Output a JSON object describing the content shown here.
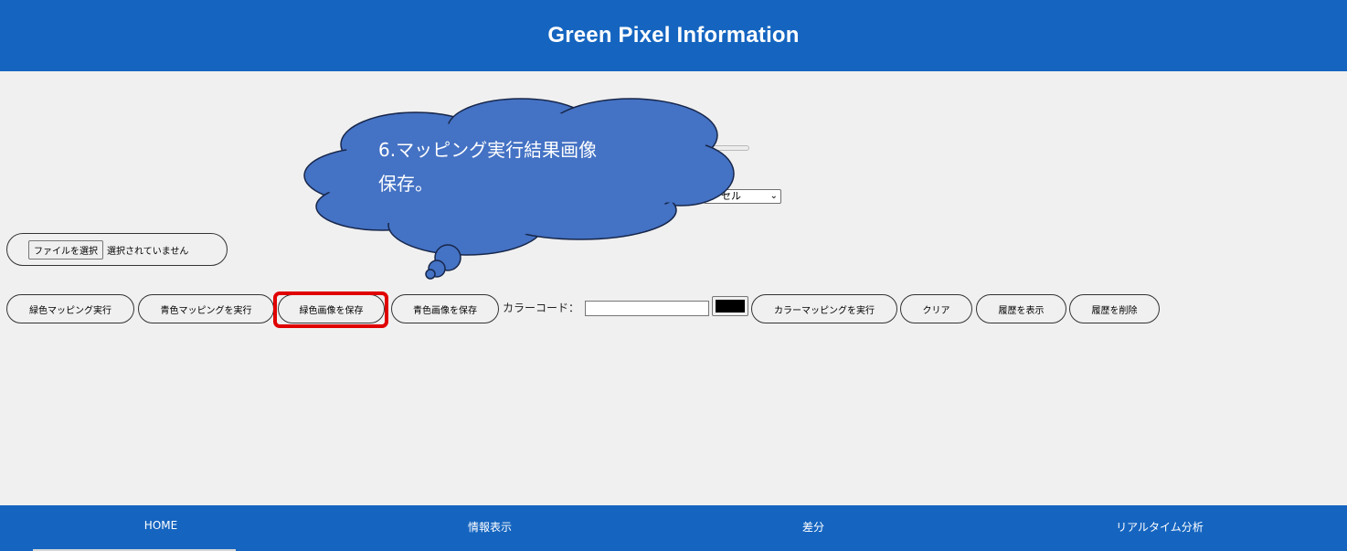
{
  "header": {
    "title": "Green Pixel Information"
  },
  "settings": {
    "select_value": "セル",
    "select_chevron": "⌄"
  },
  "file": {
    "choose_label": "ファイルを選択",
    "status": "選択されていません"
  },
  "toolbar": {
    "green_mapping": "緑色マッピング実行",
    "blue_mapping": "青色マッピングを実行",
    "save_green": "緑色画像を保存",
    "save_blue": "青色画像を保存",
    "color_code_label": "カラーコード：",
    "color_code_value": "",
    "color_swatch": "#000000",
    "color_mapping": "カラーマッピングを実行",
    "clear": "クリア",
    "show_history": "履歴を表示",
    "delete_history": "履歴を削除"
  },
  "callout": {
    "line1": "6.マッピング実行結果画像",
    "line2": "保存。"
  },
  "nav": {
    "home": "HOME",
    "info": "情報表示",
    "diff": "差分",
    "realtime": "リアルタイム分析"
  },
  "colors": {
    "brand": "#1565c0",
    "callout_fill": "#4472c4",
    "highlight": "#e00000"
  }
}
